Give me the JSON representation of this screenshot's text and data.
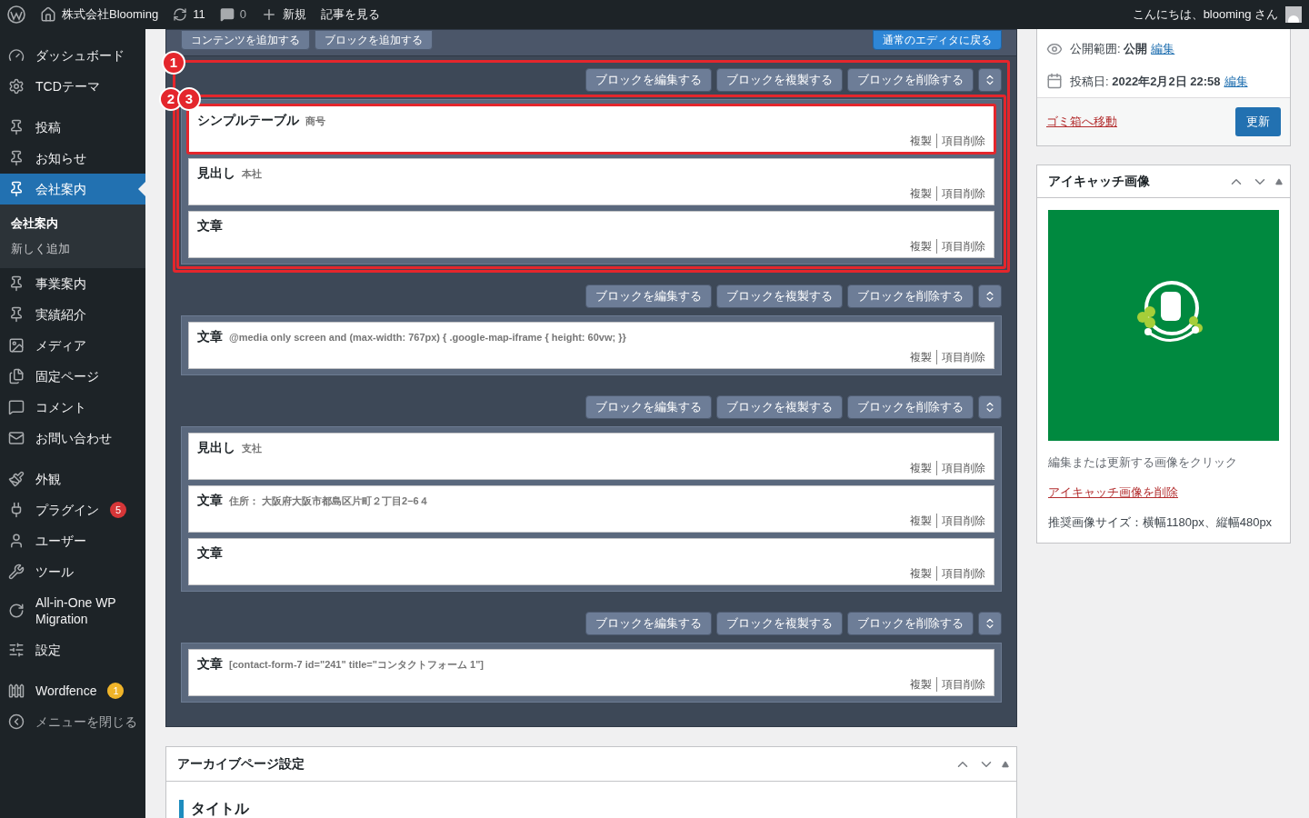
{
  "admin_bar": {
    "site_name": "株式会社Blooming",
    "updates": "11",
    "comments": "0",
    "new": "新規",
    "view": "記事を見る",
    "greeting": "こんにちは、blooming さん"
  },
  "sidebar": {
    "groups": [
      {
        "items": [
          {
            "label": "ダッシュボード",
            "selected": false
          },
          {
            "label": "TCDテーマ",
            "selected": false
          }
        ]
      },
      {
        "items": [
          {
            "label": "投稿",
            "selected": false
          },
          {
            "label": "お知らせ",
            "selected": false
          },
          {
            "label": "会社案内",
            "selected": true,
            "children": [
              {
                "label": "会社案内",
                "selected": true
              },
              {
                "label": "新しく追加",
                "selected": false
              }
            ]
          },
          {
            "label": "事業案内",
            "selected": false
          },
          {
            "label": "実績紹介",
            "selected": false
          },
          {
            "label": "メディア",
            "selected": false
          },
          {
            "label": "固定ページ",
            "selected": false
          },
          {
            "label": "コメント",
            "selected": false
          },
          {
            "label": "お問い合わせ",
            "selected": false
          }
        ]
      },
      {
        "items": [
          {
            "label": "外観",
            "selected": false
          },
          {
            "label": "プラグイン",
            "selected": false,
            "badge": {
              "text": "5",
              "color": "#d63638"
            }
          },
          {
            "label": "ユーザー",
            "selected": false
          },
          {
            "label": "ツール",
            "selected": false
          },
          {
            "label": "All-in-One WP Migration",
            "selected": false
          },
          {
            "label": "設定",
            "selected": false
          }
        ]
      },
      {
        "items": [
          {
            "label": "Wordfence",
            "selected": false,
            "badge": {
              "text": "1",
              "color": "#f0b429"
            }
          }
        ]
      }
    ],
    "collapse": "メニューを閉じる"
  },
  "editor": {
    "top_buttons": [
      "コンテンツを追加する",
      "ブロックを追加する"
    ],
    "back_button": "通常のエディタに戻る",
    "groups": [
      {
        "marker": "1",
        "list_marker": "2",
        "buttons": [
          "ブロックを編集する",
          "ブロックを複製する",
          "ブロックを削除する"
        ],
        "items": [
          {
            "title": "シンプルテーブル",
            "note": "商号",
            "marker": "3",
            "actions": [
              "複製",
              "項目削除"
            ]
          },
          {
            "title": "見出し",
            "note": "本社",
            "actions": [
              "複製",
              "項目削除"
            ]
          },
          {
            "title": "文章",
            "actions": [
              "複製",
              "項目削除"
            ]
          }
        ]
      },
      {
        "buttons": [
          "ブロックを編集する",
          "ブロックを複製する",
          "ブロックを削除する"
        ],
        "items": [
          {
            "title": "文章",
            "note": "@media only screen and (max-width: 767px) { .google-map-iframe { height: 60vw; }}",
            "actions": [
              "複製",
              "項目削除"
            ]
          }
        ]
      },
      {
        "buttons": [
          "ブロックを編集する",
          "ブロックを複製する",
          "ブロックを削除する"
        ],
        "items": [
          {
            "title": "見出し",
            "note": "支社",
            "actions": [
              "複製",
              "項目削除"
            ]
          },
          {
            "title": "文章",
            "note": "住所： 大阪府大阪市都島区片町２丁目2−6４",
            "actions": [
              "複製",
              "項目削除"
            ]
          },
          {
            "title": "文章",
            "actions": [
              "複製",
              "項目削除"
            ]
          }
        ]
      },
      {
        "buttons": [
          "ブロックを編集する",
          "ブロックを複製する",
          "ブロックを削除する"
        ],
        "items": [
          {
            "title": "文章",
            "note": "[contact-form-7 id=\"241\" title=\"コンタクトフォーム 1\"]",
            "actions": [
              "複製",
              "項目削除"
            ]
          }
        ]
      }
    ]
  },
  "archive_box": {
    "title": "アーカイブページ設定",
    "heading": "タイトル"
  },
  "publish": {
    "visibility_label": "公開範囲:",
    "visibility": "公開",
    "visibility_edit": "編集",
    "date_label": "投稿日:",
    "date": "2022年2月2日 22:58",
    "date_edit": "編集",
    "trash": "ゴミ箱へ移動",
    "update": "更新"
  },
  "featured_image": {
    "title": "アイキャッチ画像",
    "hint": "編集または更新する画像をクリック",
    "remove": "アイキャッチ画像を削除",
    "size_note": "推奨画像サイズ：横幅1180px、縦幅480px"
  }
}
